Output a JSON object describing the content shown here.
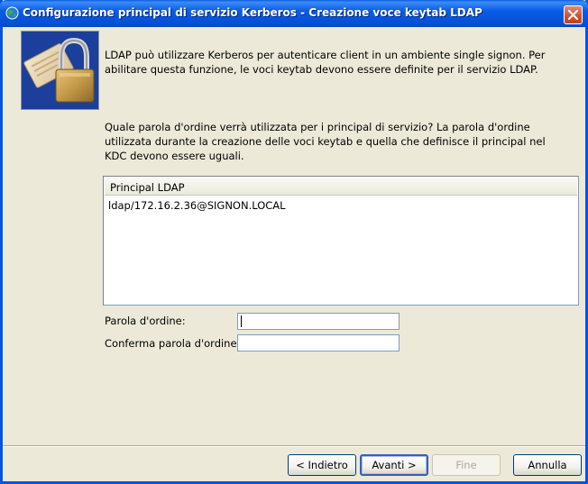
{
  "window": {
    "title": "Configurazione principal di servizio Kerberos - Creazione voce keytab LDAP"
  },
  "intro_text": "LDAP può utilizzare Kerberos per autenticare client in un ambiente single signon. Per abilitare questa funzione, le voci keytab devono essere definite per il servizio LDAP.",
  "question_text": "Quale parola d'ordine verrà utilizzata per i principal di servizio?  La parola d'ordine utilizzata durante la creazione delle voci keytab e quella che definisce il principal nel KDC devono essere uguali.",
  "principal_list": {
    "header": "Principal LDAP",
    "rows": [
      "ldap/172.16.2.36@SIGNON.LOCAL"
    ]
  },
  "password_field": {
    "label": "Parola d'ordine:",
    "value": ""
  },
  "confirm_field": {
    "label": "Conferma parola d'ordine:",
    "value": ""
  },
  "buttons": {
    "back": "< Indietro",
    "next": "Avanti >",
    "finish": "Fine",
    "cancel": "Annulla"
  },
  "icons": {
    "title": "globe-icon",
    "close": "close-icon",
    "panel": "padlock-icon"
  }
}
